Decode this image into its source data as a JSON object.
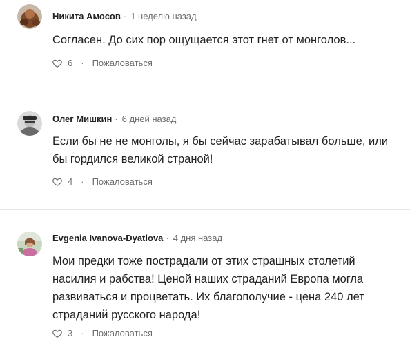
{
  "comments": [
    {
      "author": "Никита Амосов",
      "separator": "·",
      "time": "1 неделю назад",
      "text": "Согласен. До сих пор ощущается этот гнет от монголов...",
      "likes": "6",
      "actions_separator": "·",
      "report_label": "Пожаловаться",
      "avatar_icon": "user-avatar-icon"
    },
    {
      "author": "Олег Мишкин",
      "separator": "·",
      "time": "6 дней назад",
      "text": "Если бы не не монголы, я бы сейчас зарабатывал больше, или бы гордился великой страной!",
      "likes": "4",
      "actions_separator": "·",
      "report_label": "Пожаловаться",
      "avatar_icon": "user-avatar-icon"
    },
    {
      "author": "Evgenia Ivanova-Dyatlova",
      "separator": "·",
      "time": "4 дня назад",
      "text": "Мои предки тоже пострадали от этих страшных столетий насилия и рабства! Ценой наших страданий Европа могла развиваться и процветать. Их благополучие - цена 240 лет страданий русского народа!",
      "likes": "3",
      "actions_separator": "·",
      "report_label": "Пожаловаться",
      "avatar_icon": "user-avatar-icon"
    }
  ],
  "colors": {
    "text": "#222222",
    "muted": "#6b6b6b",
    "divider": "#e6e6e6"
  },
  "icons": [
    "heart-icon",
    "user-avatar-icon"
  ]
}
